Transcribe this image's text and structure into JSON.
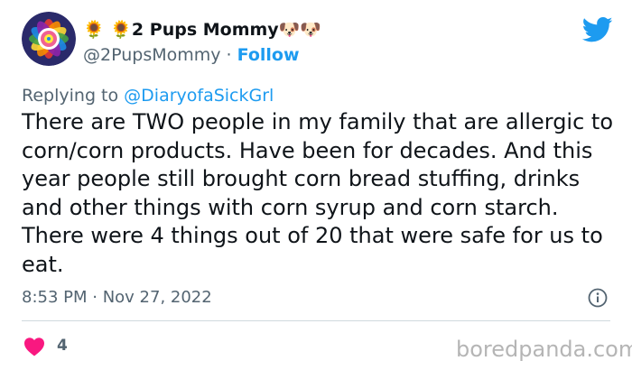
{
  "tweet": {
    "display_name": "🌻 🌻2 Pups Mommy🐶🐶",
    "handle": "@2PupsMommy",
    "separator": " · ",
    "follow_label": "Follow",
    "reply_prefix": "Replying to ",
    "reply_mention": "@DiaryofaSickGrl",
    "text": "There are TWO people in my family that are allergic to corn/corn products. Have been for decades. And this year people still brought corn bread stuffing, drinks and other things with corn syrup and corn starch. There were 4 things out of 20 that were safe for us to eat.",
    "timestamp": "8:53 PM · Nov 27, 2022",
    "like_count": "4"
  },
  "watermark": "boredpanda.com",
  "colors": {
    "accent": "#1d9bf0",
    "like": "#f91880",
    "muted_text": "#536471",
    "divider": "#cfd9de"
  },
  "icons": {
    "logo": "twitter-bird-icon",
    "info": "info-icon",
    "like": "heart-icon"
  }
}
